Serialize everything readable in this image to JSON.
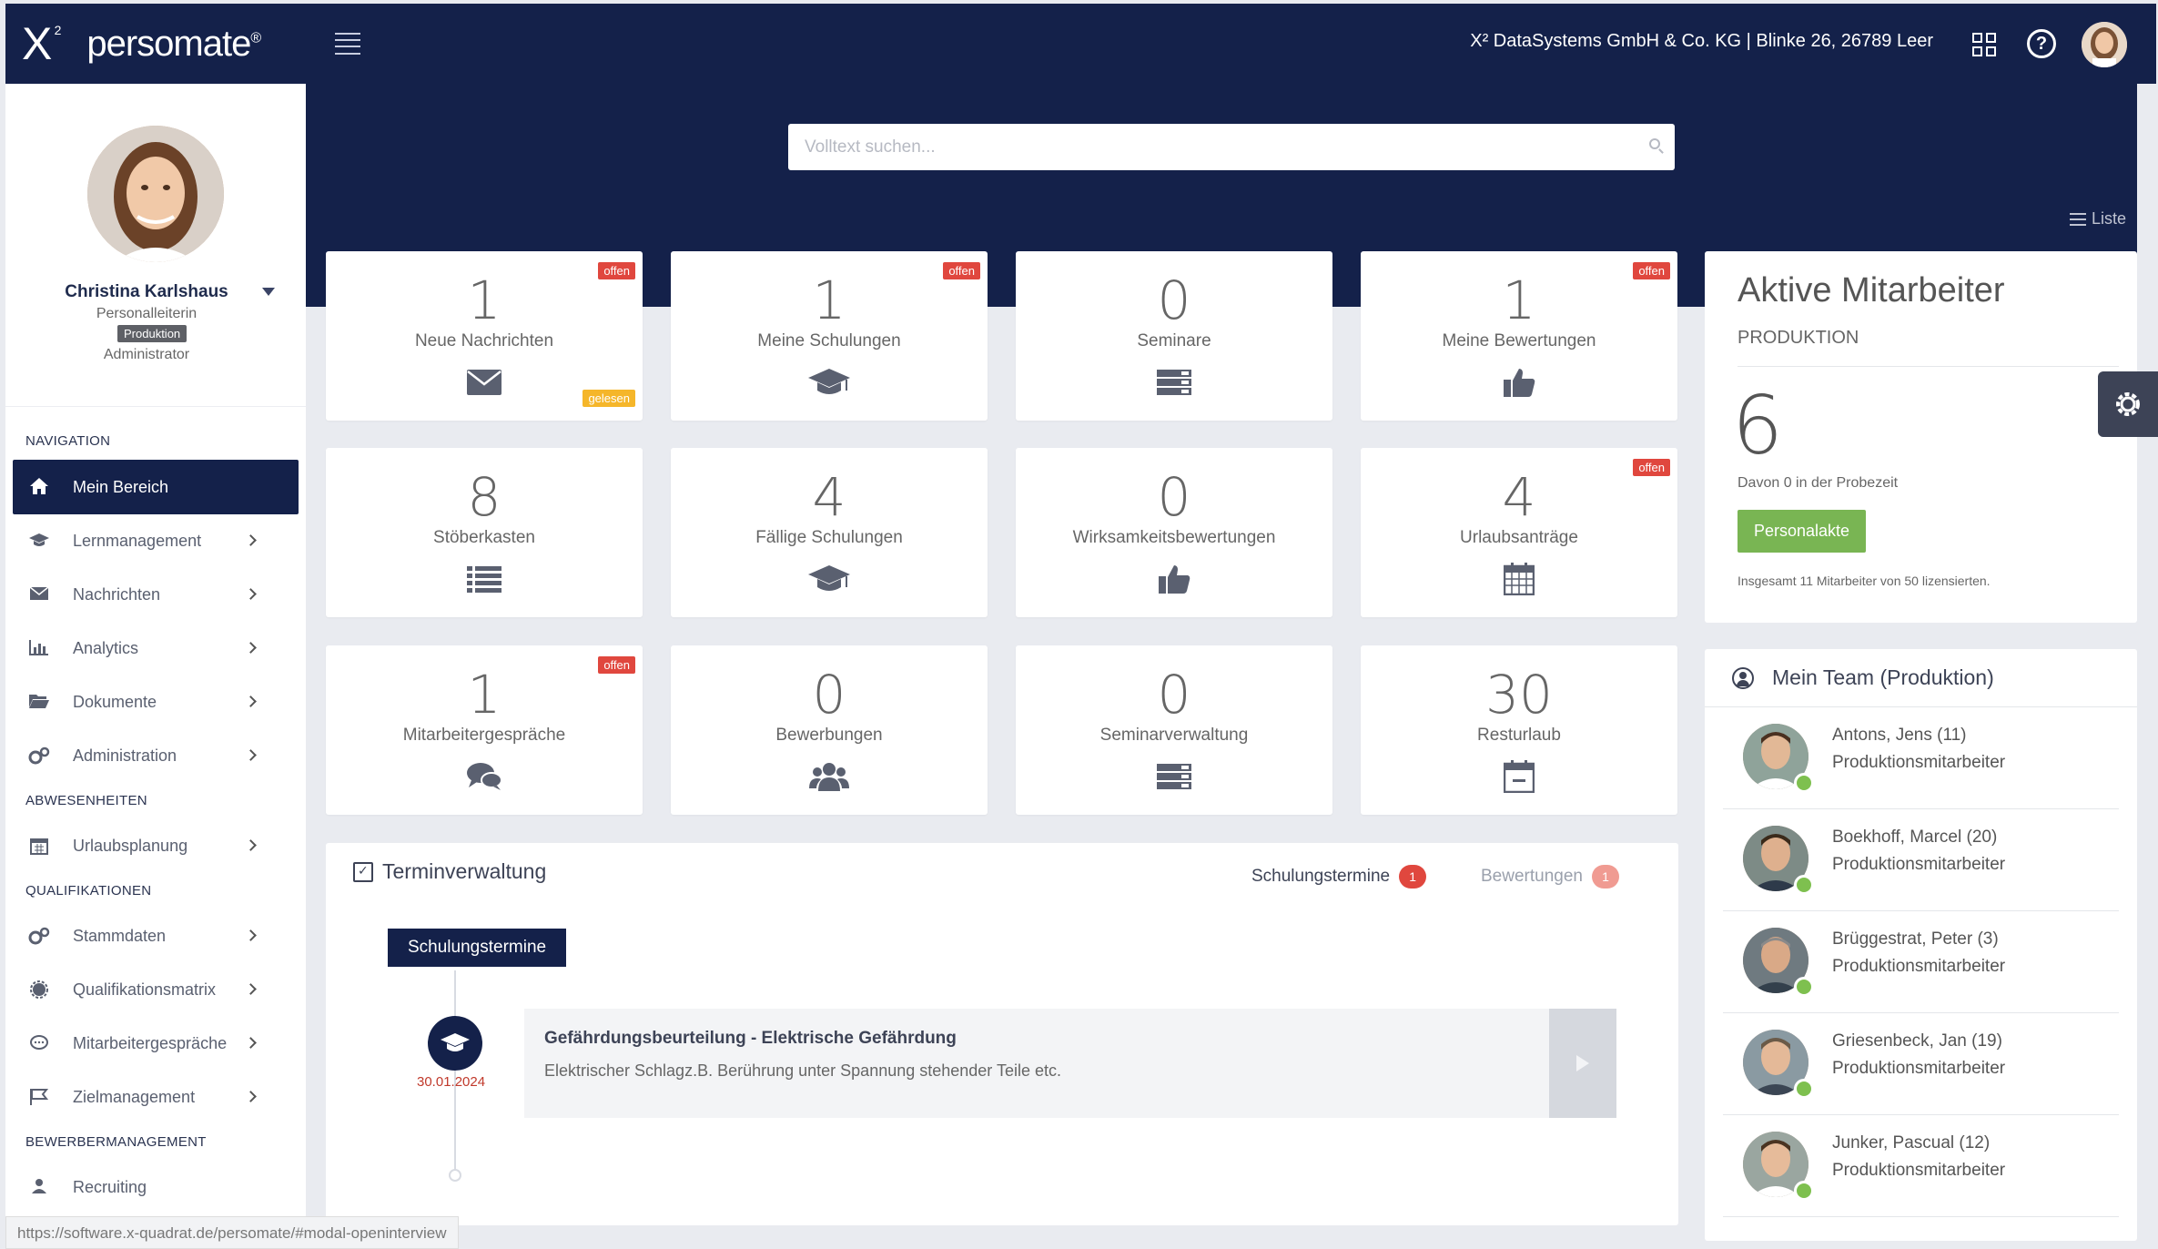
{
  "header": {
    "logo_mark": "X",
    "logo_sup": "2",
    "logo_name": "persomate",
    "logo_reg": "®",
    "company": "X² DataSystems GmbH & Co. KG | Blinke 26, 26789 Leer",
    "icons": [
      "menu-icon",
      "apps-grid-icon",
      "help-icon",
      "user-avatar"
    ]
  },
  "profile": {
    "name": "Christina Karlshaus",
    "role": "Personalleiterin",
    "department_badge": "Produktion",
    "access": "Administrator"
  },
  "nav": {
    "section_navigation": "NAVIGATION",
    "mein_bereich": "Mein Bereich",
    "lernmanagement": "Lernmanagement",
    "nachrichten": "Nachrichten",
    "analytics": "Analytics",
    "dokumente": "Dokumente",
    "administration": "Administration",
    "section_abwesenheiten": "ABWESENHEITEN",
    "urlaubsplanung": "Urlaubsplanung",
    "section_qualifikationen": "QUALIFIKATIONEN",
    "stammdaten": "Stammdaten",
    "qualifikationsmatrix": "Qualifikationsmatrix",
    "mitarbeitergespraeche": "Mitarbeitergespräche",
    "zielmanagement": "Zielmanagement",
    "section_bewerber": "BEWERBERMANAGEMENT",
    "recruiting": "Recruiting"
  },
  "status_url": "https://software.x-quadrat.de/persomate/#modal-openinterview",
  "search": {
    "placeholder": "Volltext suchen..."
  },
  "view_toggle": "Liste",
  "tiles": [
    {
      "num": "1",
      "label": "Neue Nachrichten",
      "badge": "offen",
      "badge2": "gelesen",
      "icon": "envelope-icon"
    },
    {
      "num": "1",
      "label": "Meine Schulungen",
      "badge": "offen",
      "icon": "graduation-cap-icon"
    },
    {
      "num": "0",
      "label": "Seminare",
      "icon": "server-stack-icon"
    },
    {
      "num": "1",
      "label": "Meine Bewertungen",
      "badge": "offen",
      "icon": "thumbs-up-icon"
    },
    {
      "num": "8",
      "label": "Stöberkasten",
      "icon": "list-icon"
    },
    {
      "num": "4",
      "label": "Fällige Schulungen",
      "icon": "graduation-cap-icon"
    },
    {
      "num": "0",
      "label": "Wirksamkeitsbewertungen",
      "icon": "thumbs-up-icon"
    },
    {
      "num": "4",
      "label": "Urlaubsanträge",
      "badge": "offen",
      "icon": "calendar-grid-icon"
    },
    {
      "num": "1",
      "label": "Mitarbeitergespräche",
      "badge": "offen",
      "icon": "chat-bubbles-icon"
    },
    {
      "num": "0",
      "label": "Bewerbungen",
      "icon": "users-group-icon"
    },
    {
      "num": "0",
      "label": "Seminarverwaltung",
      "icon": "server-stack-icon"
    },
    {
      "num": "30",
      "label": "Resturlaub",
      "icon": "calendar-minus-icon"
    }
  ],
  "active_staff": {
    "title": "Aktive Mitarbeiter",
    "department": "PRODUKTION",
    "count": "6",
    "probation_note": "Davon 0 in der Probezeit",
    "button": "Personalakte",
    "license_note": "Insgesamt 11 Mitarbeiter von 50 lizensierten.",
    "button_color": "#79b553"
  },
  "team": {
    "title": "Mein Team (Produktion)",
    "members": [
      {
        "name": "Antons, Jens (11)",
        "role": "Produktionsmitarbeiter"
      },
      {
        "name": "Boekhoff, Marcel (20)",
        "role": "Produktionsmitarbeiter"
      },
      {
        "name": "Brüggestrat, Peter (3)",
        "role": "Produktionsmitarbeiter"
      },
      {
        "name": "Griesenbeck, Jan (19)",
        "role": "Produktionsmitarbeiter"
      },
      {
        "name": "Junker, Pascual (12)",
        "role": "Produktionsmitarbeiter"
      }
    ]
  },
  "termine": {
    "title": "Terminverwaltung",
    "tab_schulung": "Schulungstermine",
    "tab_schulung_count": "1",
    "tab_bewertung": "Bewertungen",
    "tab_bewertung_count": "1",
    "section_label": "Schulungstermine",
    "event_date": "30.01.2024",
    "event_title": "Gefährdungsbeurteilung - Elektrische Gefährdung",
    "event_desc": "Elektrischer Schlagz.B. Berührung unter Spannung stehender Teile etc."
  },
  "colors": {
    "primary": "#14214a",
    "alert": "#e0473e",
    "warning": "#f5b62a",
    "success": "#79b553",
    "online": "#7ec04f"
  }
}
